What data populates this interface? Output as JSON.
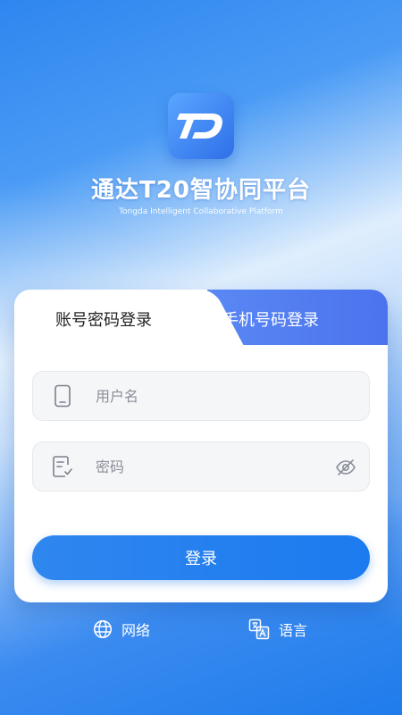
{
  "app": {
    "title": "通达T20智协同平台",
    "subtitle": "Tongda Intelligent Collaborative Platform",
    "logo_text": "TD"
  },
  "tabs": {
    "account": "账号密码登录",
    "phone": "手机号码登录",
    "active": "account"
  },
  "form": {
    "username_placeholder": "用户名",
    "password_placeholder": "密码",
    "login_label": "登录"
  },
  "footer": {
    "network_label": "网络",
    "language_label": "语言"
  },
  "colors": {
    "primary": "#1c7bef",
    "tab_active_bg": "#ffffff",
    "tab_inactive_bg": "#4b73ee"
  },
  "icons": [
    "phone-icon",
    "edit-icon",
    "eye-off-icon",
    "globe-icon",
    "translate-icon"
  ]
}
